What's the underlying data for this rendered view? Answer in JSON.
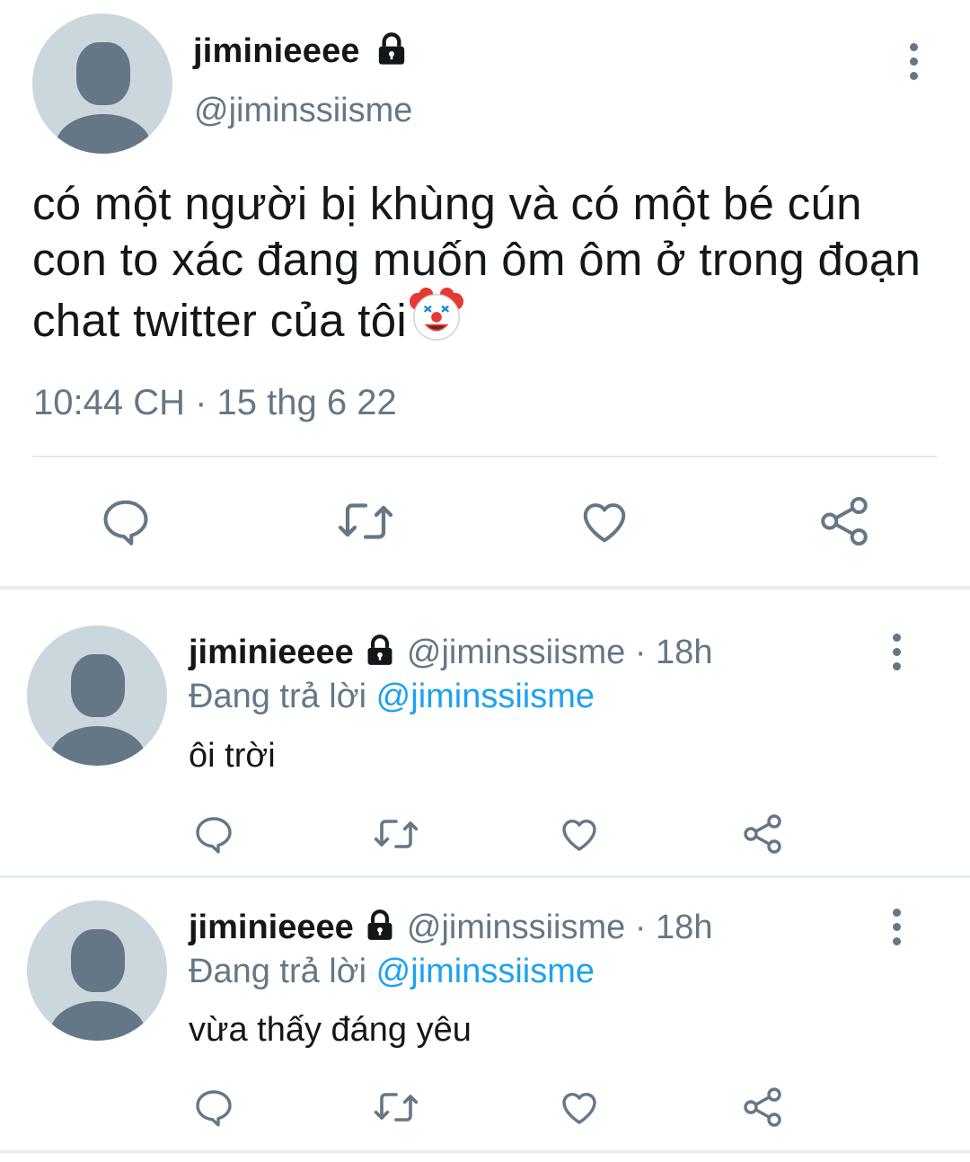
{
  "main_tweet": {
    "name": "jiminieeee",
    "handle": "@jiminssiisme",
    "text": "có một người bị khùng và có một bé cún con to xác đang muốn ôm ôm ở trong đoạn chat twitter của tôi",
    "emoji": "clown-face",
    "timestamp": "10:44 CH · 15 thg 6 22"
  },
  "replies": [
    {
      "name": "jiminieeee",
      "handle": "@jiminssiisme",
      "dot": "·",
      "time": "18h",
      "replying_prefix": "Đang trả lời",
      "replying_to": "@jiminssiisme",
      "text": "ôi trời"
    },
    {
      "name": "jiminieeee",
      "handle": "@jiminssiisme",
      "dot": "·",
      "time": "18h",
      "replying_prefix": "Đang trả lời",
      "replying_to": "@jiminssiisme",
      "text": "vừa thấy đáng yêu"
    }
  ],
  "icons": [
    "lock-icon",
    "more-icon",
    "reply-icon",
    "retweet-icon",
    "like-icon",
    "share-icon"
  ],
  "colors": {
    "text": "#14171a",
    "secondary": "#657786",
    "link": "#1da1f2",
    "divider": "#e6ecf0",
    "avatar_bg": "#ccd6dd"
  }
}
